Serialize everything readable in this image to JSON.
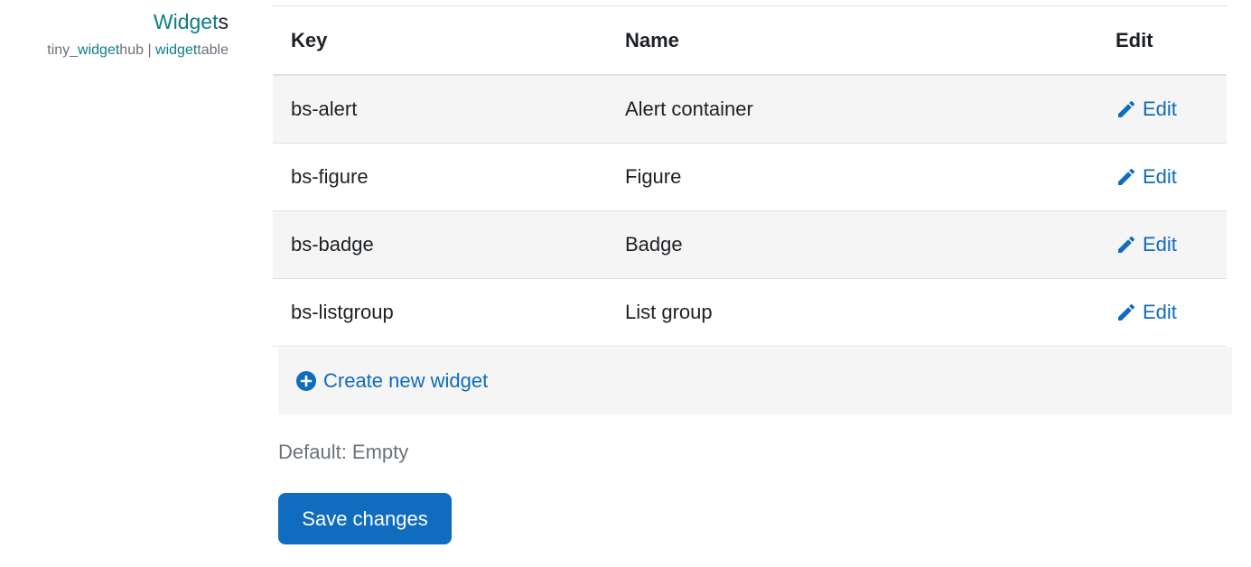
{
  "setting": {
    "title_part1": "Widget",
    "title_part2": "s",
    "name_part1": "tiny_",
    "name_part2": "widget",
    "name_part3": "hub | ",
    "name_part4": "widget",
    "name_part5": "table"
  },
  "table": {
    "headers": {
      "key": "Key",
      "name": "Name",
      "edit": "Edit"
    },
    "rows": [
      {
        "key": "bs-alert",
        "name": "Alert container",
        "edit": "Edit"
      },
      {
        "key": "bs-figure",
        "name": "Figure",
        "edit": "Edit"
      },
      {
        "key": "bs-badge",
        "name": "Badge",
        "edit": "Edit"
      },
      {
        "key": "bs-listgroup",
        "name": "List group",
        "edit": "Edit"
      }
    ]
  },
  "create": {
    "label": "Create new widget",
    "icon": "plus-circle-icon"
  },
  "default_text": "Default: Empty",
  "save_label": "Save changes",
  "colors": {
    "link": "#0f6cbf",
    "teal": "#0e7c86",
    "stripe": "#f5f5f5",
    "muted": "#6a737b"
  }
}
